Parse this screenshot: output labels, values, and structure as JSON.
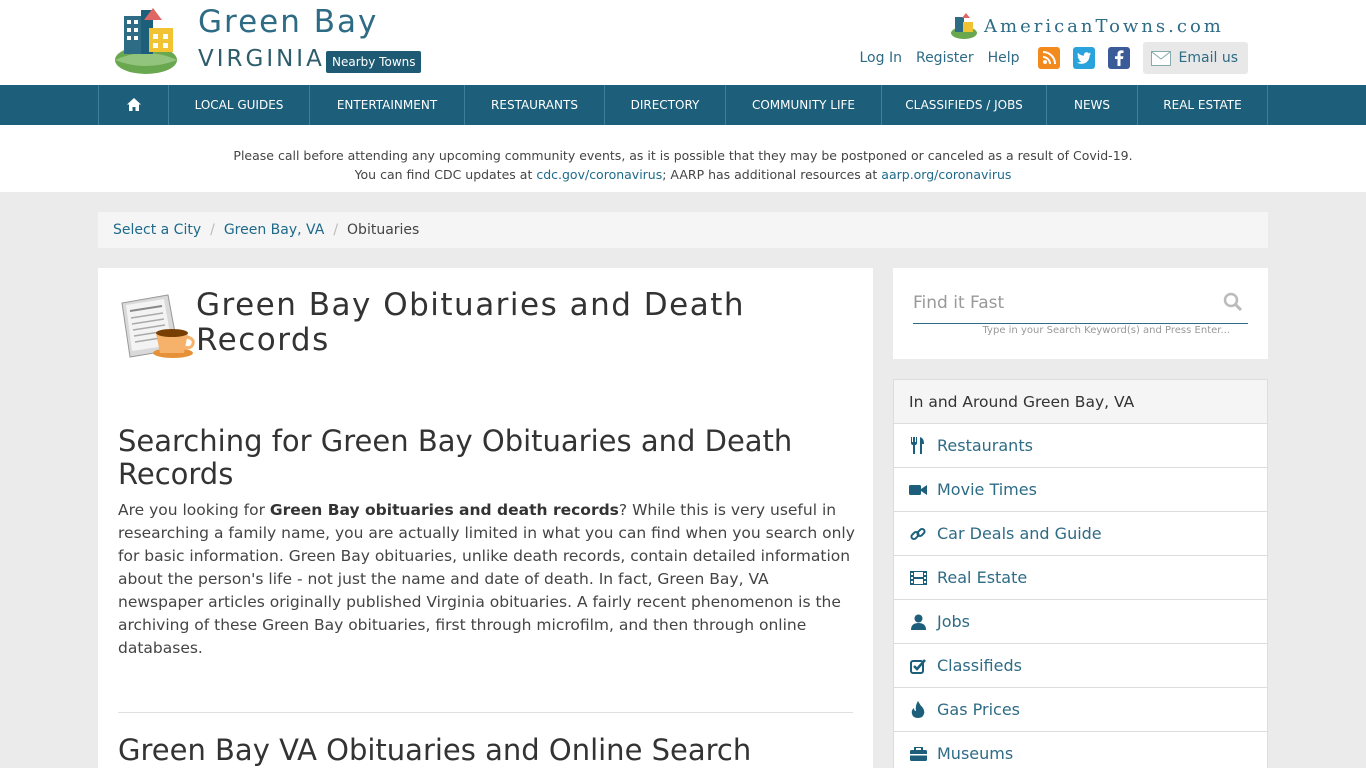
{
  "header": {
    "town": "Green Bay",
    "state": "VIRGINIA",
    "nearby_label": "Nearby Towns",
    "brand": "AmericanTowns.com",
    "login": "Log In",
    "register": "Register",
    "help": "Help",
    "email_label": "Email us"
  },
  "nav": {
    "items": [
      "LOCAL GUIDES",
      "ENTERTAINMENT",
      "RESTAURANTS",
      "DIRECTORY",
      "COMMUNITY LIFE",
      "CLASSIFIEDS / JOBS",
      "NEWS",
      "REAL ESTATE"
    ]
  },
  "notice": {
    "line1": "Please call before attending any upcoming community events, as it is possible that they may be postponed or canceled as a result of Covid-19.",
    "line2_pre": "You can find CDC updates at ",
    "cdc_link": "cdc.gov/coronavirus",
    "line2_mid": "; AARP has additional resources at ",
    "aarp_link": "aarp.org/coronavirus"
  },
  "breadcrumb": {
    "items": [
      "Select a City",
      "Green Bay, VA",
      "Obituaries"
    ]
  },
  "main": {
    "title": "Green Bay Obituaries and Death Records",
    "section1_title": "Searching for Green Bay Obituaries and Death Records",
    "intro_pre": "Are you looking for ",
    "intro_bold": "Green Bay obituaries and death records",
    "intro_post": "? While this is very useful in researching a family name, you are actually limited in what you can find when you search only for basic information. Green Bay obituaries, unlike death records, contain detailed information about the person's life - not just the name and date of death. In fact, Green Bay, VA newspaper articles originally published Virginia obituaries. A fairly recent phenomenon is the archiving of these Green Bay obituaries, first through microfilm, and then through online databases.",
    "section2_title": "Green Bay VA Obituaries and Online Search"
  },
  "search": {
    "placeholder": "Find it Fast",
    "hint": "Type in your Search Keyword(s) and Press Enter..."
  },
  "sidebar": {
    "heading": "In and Around Green Bay, VA",
    "items": [
      {
        "label": "Restaurants",
        "icon": "fork-knife-icon"
      },
      {
        "label": "Movie Times",
        "icon": "video-camera-icon"
      },
      {
        "label": "Car Deals and Guide",
        "icon": "link-icon"
      },
      {
        "label": "Real Estate",
        "icon": "film-icon"
      },
      {
        "label": "Jobs",
        "icon": "user-icon"
      },
      {
        "label": "Classifieds",
        "icon": "check-square-icon"
      },
      {
        "label": "Gas Prices",
        "icon": "fire-icon"
      },
      {
        "label": "Museums",
        "icon": "briefcase-icon"
      }
    ]
  },
  "colors": {
    "nav_bg": "#1d5f7a",
    "link": "#2e6b85",
    "page_bg": "#ebebeb"
  }
}
